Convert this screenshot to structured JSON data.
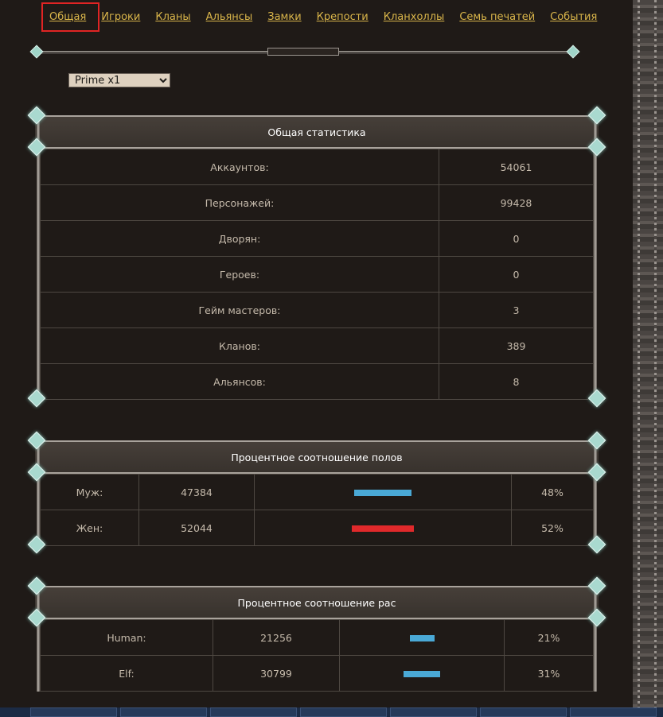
{
  "nav": {
    "items": [
      {
        "label": "Общая",
        "active": true
      },
      {
        "label": "Игроки"
      },
      {
        "label": "Кланы"
      },
      {
        "label": "Альянсы"
      },
      {
        "label": "Замки"
      },
      {
        "label": "Крепости"
      },
      {
        "label": "Кланхоллы"
      },
      {
        "label": "Семь печатей"
      },
      {
        "label": "События"
      }
    ]
  },
  "server_select": {
    "value": "Prime x1"
  },
  "general": {
    "title": "Общая статистика",
    "rows": [
      {
        "label": "Аккаунтов:",
        "value": "54061"
      },
      {
        "label": "Персонажей:",
        "value": "99428"
      },
      {
        "label": "Дворян:",
        "value": "0"
      },
      {
        "label": "Героев:",
        "value": "0"
      },
      {
        "label": "Гейм мастеров:",
        "value": "3"
      },
      {
        "label": "Кланов:",
        "value": "389"
      },
      {
        "label": "Альянсов:",
        "value": "8"
      }
    ]
  },
  "gender": {
    "title": "Процентное соотношение полов",
    "rows": [
      {
        "label": "Муж:",
        "count": "47384",
        "percent": "48%",
        "fraction": 0.48,
        "color": "#4aa9d6"
      },
      {
        "label": "Жен:",
        "count": "52044",
        "percent": "52%",
        "fraction": 0.52,
        "color": "#e0292b"
      }
    ]
  },
  "race": {
    "title": "Процентное соотношение рас",
    "rows": [
      {
        "label": "Human:",
        "count": "21256",
        "percent": "21%",
        "fraction": 0.21,
        "color": "#4aa9d6"
      },
      {
        "label": "Elf:",
        "count": "30799",
        "percent": "31%",
        "fraction": 0.31,
        "color": "#4aa9d6"
      }
    ]
  },
  "colors": {
    "link": "#d9b54a",
    "active_outline": "#e02424"
  }
}
